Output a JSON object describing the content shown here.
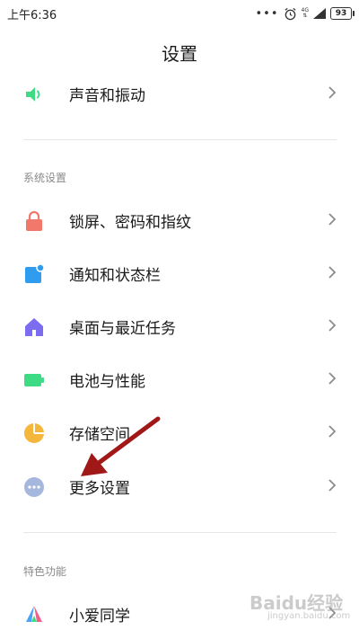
{
  "status_bar": {
    "time": "上午6:36",
    "dots": "•••",
    "network": "4G",
    "battery": "93"
  },
  "header": {
    "title": "设置"
  },
  "items_top": [
    {
      "label": "声音和振动",
      "icon": "speaker-icon",
      "color": "#3ddc84"
    }
  ],
  "sections": [
    {
      "title": "系统设置",
      "items": [
        {
          "label": "锁屏、密码和指纹",
          "icon": "lock-icon",
          "color": "#f1786a"
        },
        {
          "label": "通知和状态栏",
          "icon": "notification-icon",
          "color": "#2f9cf0"
        },
        {
          "label": "桌面与最近任务",
          "icon": "home-icon",
          "color": "#7b6cf0"
        },
        {
          "label": "电池与性能",
          "icon": "battery-icon",
          "color": "#3ddc84"
        },
        {
          "label": "存储空间",
          "icon": "storage-pie-icon",
          "color": "#f5b63c"
        },
        {
          "label": "更多设置",
          "icon": "more-dots-icon",
          "color": "#a6b7dd"
        }
      ]
    },
    {
      "title": "特色功能",
      "items": [
        {
          "label": "小爱同学",
          "icon": "xiaoai-icon",
          "color": "#3ddc84"
        }
      ]
    }
  ],
  "annotation": {
    "arrow_color": "#a01818"
  },
  "watermark": {
    "text": "Baidu经验",
    "sub": "jingyan.baidu.com"
  }
}
